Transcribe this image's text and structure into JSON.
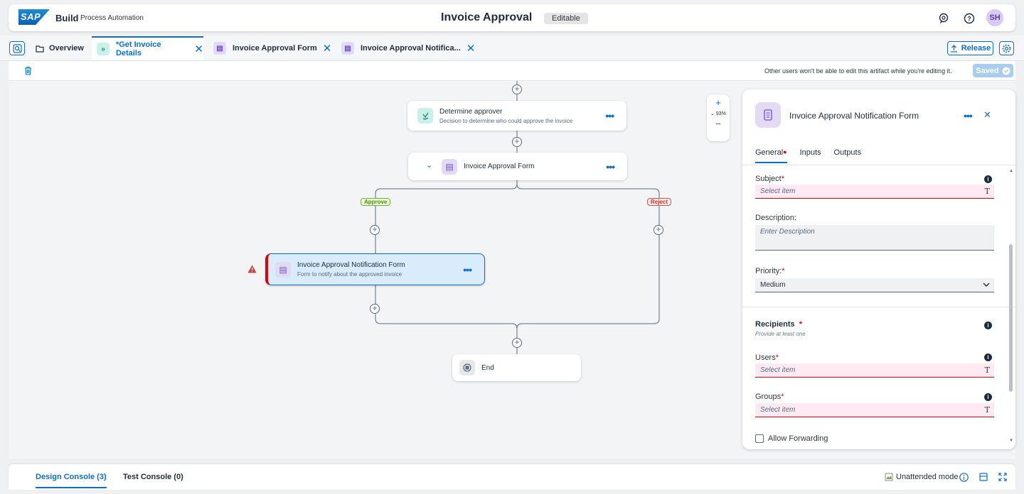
{
  "shell": {
    "logo_text": "SAP",
    "brand": "Build",
    "product": "Process Automation",
    "title": "Invoice Approval",
    "status_tag": "Editable",
    "avatar_initials": "SH"
  },
  "tabs": {
    "overview": "Overview",
    "items": [
      {
        "label": "*Get Invoice Details",
        "icon": "process-icon"
      },
      {
        "label": "Invoice Approval Form",
        "icon": "form-icon"
      },
      {
        "label": "Invoice Approval Notifica...",
        "icon": "form-icon"
      }
    ],
    "release": "Release"
  },
  "toolbar": {
    "lock_note": "Other users won't be able to edit this artifact while you're editing it.",
    "saved": "Saved"
  },
  "canvas": {
    "zoom_level": "93%",
    "nodes": {
      "decision": {
        "title": "Determine approver",
        "subtitle": "Decision to determine who could approve the invoice"
      },
      "form": {
        "title": "Invoice Approval Form"
      },
      "notification": {
        "title": "Invoice Approval Notification Form",
        "subtitle": "Form to notify about the approved invoice"
      },
      "end": {
        "title": "End"
      }
    },
    "branches": {
      "approve": "Approve",
      "reject": "Reject"
    }
  },
  "panel": {
    "title": "Invoice Approval Notification Form",
    "tabs": [
      "General",
      "Inputs",
      "Outputs"
    ],
    "subject_label": "Subject",
    "subject_placeholder": "Select item",
    "description_label": "Description:",
    "description_placeholder": "Enter Description",
    "priority_label": "Priority:",
    "priority_value": "Medium",
    "recipients_title": "Recipients",
    "recipients_hint": "Provide at least one",
    "users_label": "Users",
    "users_placeholder": "Select item",
    "groups_label": "Groups",
    "groups_placeholder": "Select item",
    "allow_forwarding": "Allow Forwarding",
    "required_mark": "*"
  },
  "console": {
    "design": "Design Console (3)",
    "test": "Test Console (0)",
    "mode": "Unattended mode"
  },
  "colors": {
    "accent": "#0a6ed1",
    "error": "#d20a0a",
    "approve": "#4a8a17",
    "reject": "#c0392b"
  }
}
